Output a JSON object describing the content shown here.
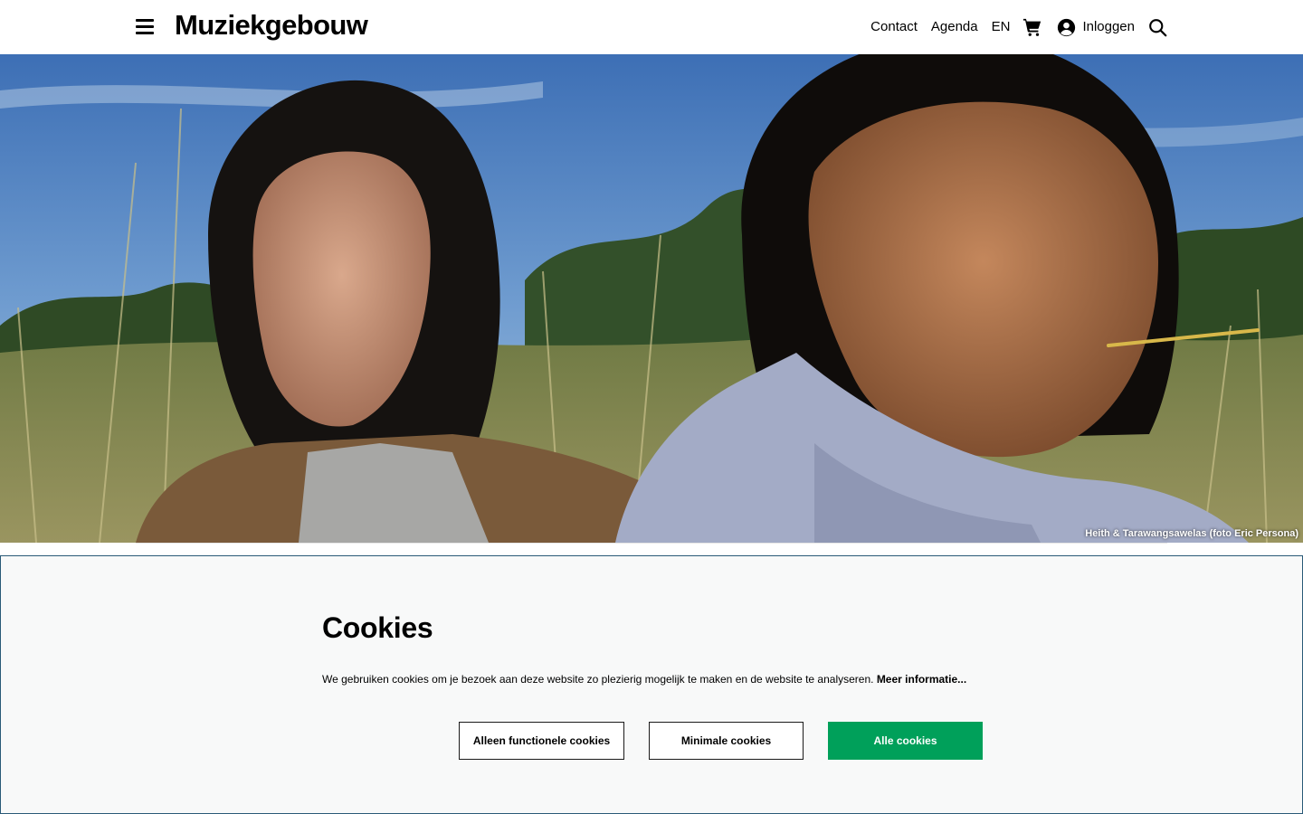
{
  "header": {
    "logo": "Muziekgebouw",
    "nav": {
      "contact": "Contact",
      "agenda": "Agenda",
      "language": "EN",
      "login": "Inloggen"
    },
    "icons": [
      "menu-icon",
      "cart-icon",
      "user-icon",
      "search-icon"
    ]
  },
  "hero": {
    "caption": "Heith & Tarawangsawelas (foto Eric Persona)"
  },
  "cookie_banner": {
    "title": "Cookies",
    "text": "We gebruiken cookies om je bezoek aan deze website zo plezierig mogelijk te maken en de website te analyseren.",
    "more_link": "Meer informatie...",
    "buttons": {
      "functional": "Alleen functionele cookies",
      "minimal": "Minimale cookies",
      "all": "Alle cookies"
    }
  },
  "colors": {
    "accent_green": "#00a05a",
    "banner_border": "#2a5a78",
    "banner_background": "#f8f9f9"
  }
}
